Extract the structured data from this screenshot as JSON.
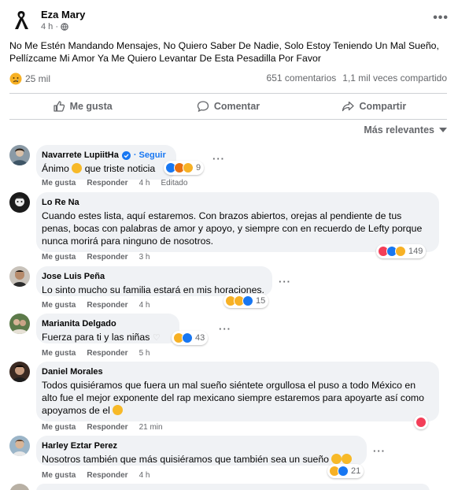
{
  "post": {
    "author": "Eza Mary",
    "time": "4 h ·",
    "more_label": "•••",
    "text": "No Me Estén Mandando Mensajes, No Quiero Saber De Nadie, Solo Estoy Teniendo Un Mal Sueño, Pellízcame Mi Amor Ya Me Quiero Levantar De Esta Pesadilla Por Favor",
    "reactions": "25 mil",
    "comments_count": "651 comentarios",
    "shares_count": "1,1 mil veces compartido"
  },
  "actions": {
    "like": "Me gusta",
    "comment": "Comentar",
    "share": "Compartir"
  },
  "sort_label": "Más relevantes",
  "comment_actions": {
    "like": "Me gusta",
    "reply": "Responder"
  },
  "comments": [
    {
      "name": "Navarrete LupiitHa",
      "follow": "· Seguir",
      "text_a": "Ánimo",
      "text_b": "que triste noticia",
      "time": "4 h",
      "edited": "Editado",
      "reaction_count": "9"
    },
    {
      "name": "Lo Re Na",
      "text": "Cuando estes lista, aquí estaremos. Con brazos abiertos, orejas al pendiente de tus penas, bocas con palabras de amor y apoyo, y siempre con en recuerdo de Lefty porque nunca morirá para ninguno de nosotros.",
      "time": "3 h",
      "reaction_count": "149"
    },
    {
      "name": "Jose Luis Peña",
      "text": "Lo sinto mucho su familia estará en mis horaciones.",
      "time": "4 h",
      "reaction_count": "15"
    },
    {
      "name": "Marianita Delgado",
      "text": "Fuerza para ti y las niñas",
      "time": "5 h",
      "reaction_count": "43"
    },
    {
      "name": "Daniel Morales",
      "text": "Todos quisiéramos que fuera un mal sueño siéntete orgullosa el puso a todo México en alto fue el mejor exponente del rap mexicano siempre estaremos para apoyarte así como apoyamos de el",
      "time": "21 min",
      "reaction_count": ""
    },
    {
      "name": "Harley Eztar Perez",
      "text": "Nosotros también que más quisiéramos que también sea un sueño",
      "time": "4 h",
      "reaction_count": "21"
    }
  ],
  "colors": {
    "accent": "#1877f2",
    "secondary_text": "#65676b",
    "bubble": "#f0f2f5"
  }
}
